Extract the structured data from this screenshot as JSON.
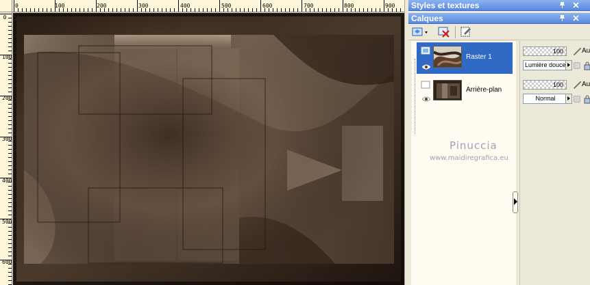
{
  "rulers": {
    "top_ticks": [
      "0",
      "100",
      "200",
      "300",
      "400",
      "500",
      "600",
      "700",
      "800",
      "900"
    ],
    "left_ticks": [
      "0",
      "100",
      "200",
      "300",
      "400",
      "500",
      "600"
    ]
  },
  "palettes": {
    "styles_title": "Styles et textures",
    "layers_title": "Calques"
  },
  "layers": [
    {
      "name": "Raster 1",
      "selected": true,
      "opacity": "100",
      "blend_mode": "Lumière douce",
      "au_label": "Au"
    },
    {
      "name": "Arrière-plan",
      "selected": false,
      "opacity": "100",
      "blend_mode": "Normal",
      "au_label": "Au"
    }
  ],
  "watermark": {
    "name": "Pinuccia",
    "url": "www.maidiregrafica.eu"
  },
  "icons": {
    "pin": "pin-icon",
    "close": "close-icon",
    "new_layer": "new-layer-icon",
    "delete_layer": "delete-layer-icon",
    "layer_properties": "layer-properties-icon",
    "visibility": "eye-icon",
    "brush": "brush-icon",
    "lock": "lock-icon"
  },
  "colors": {
    "palette_bar": "#5a89dd",
    "selection": "#316ac5",
    "ruler": "#fdf6d8",
    "watermark": "#9aa3b8"
  }
}
